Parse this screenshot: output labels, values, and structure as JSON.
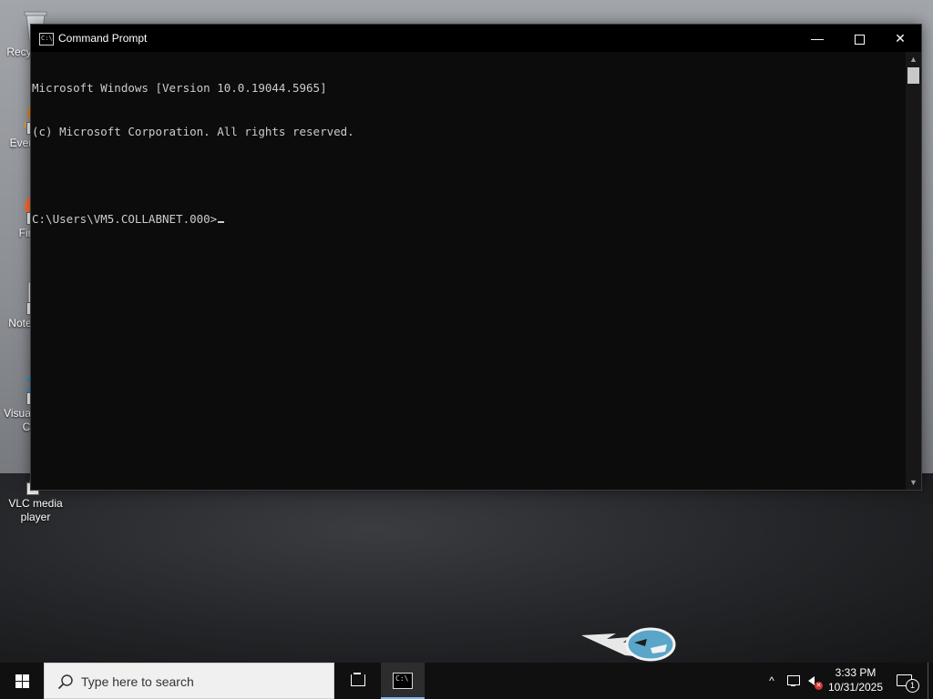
{
  "desktop": {
    "icons": [
      {
        "label": "Recycle Bin",
        "name": "recycle-bin"
      },
      {
        "label": "Everything",
        "name": "everything"
      },
      {
        "label": "Firefox",
        "name": "firefox"
      },
      {
        "label": "Notepad++",
        "name": "notepad-plus-plus"
      },
      {
        "label": "Visual Studio Code",
        "name": "visual-studio-code"
      },
      {
        "label": "VLC media player",
        "name": "vlc-media-player"
      }
    ]
  },
  "window": {
    "title": "Command Prompt",
    "icon_text": "C:\\",
    "controls": {
      "minimize": "—",
      "close": "✕"
    },
    "console": {
      "lines": [
        "Microsoft Windows [Version 10.0.19044.5965]",
        "(c) Microsoft Corporation. All rights reserved.",
        "",
        "C:\\Users\\VM5.COLLABNET.000>"
      ]
    },
    "scrollbar": {
      "up": "▲",
      "down": "▼"
    }
  },
  "taskbar": {
    "search_placeholder": "Type here to search",
    "cmd_icon_text": "C:\\",
    "tray_chevron": "^",
    "clock": {
      "time": "3:33 PM",
      "date": "10/31/2025"
    },
    "notifications_count": "1"
  },
  "colors": {
    "console_bg": "#0c0c0c",
    "console_fg": "#cccccc",
    "taskbar_bg": "#101010",
    "taskbar_active_indicator": "#7fb2f0"
  }
}
